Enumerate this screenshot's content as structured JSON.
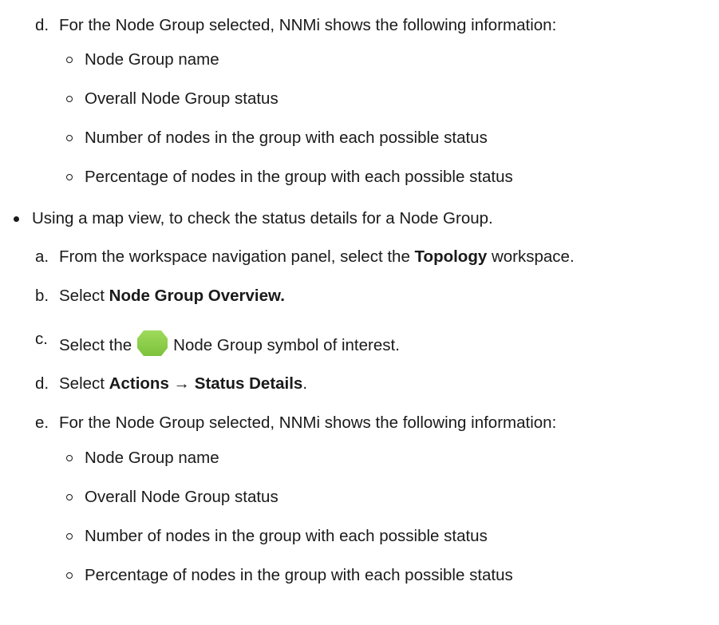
{
  "section1": {
    "step_d": {
      "marker": "d.",
      "text": "For the Node Group selected, NNMi shows the following information:"
    },
    "items": [
      "Node Group name",
      "Overall Node Group status",
      "Number of nodes in the group with each possible status",
      "Percentage of nodes in the group with each possible status"
    ]
  },
  "section2": {
    "bullet_text": "Using a map view, to check the status details for a Node Group.",
    "step_a": {
      "marker": "a.",
      "pre": "From the workspace navigation panel, select the ",
      "bold": "Topology",
      "post": " workspace."
    },
    "step_b": {
      "marker": "b.",
      "pre": "Select ",
      "bold": "Node Group Overview."
    },
    "step_c": {
      "marker": "c.",
      "pre": "Select the",
      "post": "Node Group symbol of interest.",
      "icon": "node-group-icon",
      "icon_color": "#8cd04a"
    },
    "step_d": {
      "marker": "d.",
      "pre": "Select ",
      "bold1": "Actions",
      "arrow": " → ",
      "bold2": "Status Details",
      "post": "."
    },
    "step_e": {
      "marker": "e.",
      "text": "For the Node Group selected, NNMi shows the following information:"
    },
    "items": [
      "Node Group name",
      "Overall Node Group status",
      "Number of nodes in the group with each possible status",
      "Percentage of nodes in the group with each possible status"
    ]
  }
}
